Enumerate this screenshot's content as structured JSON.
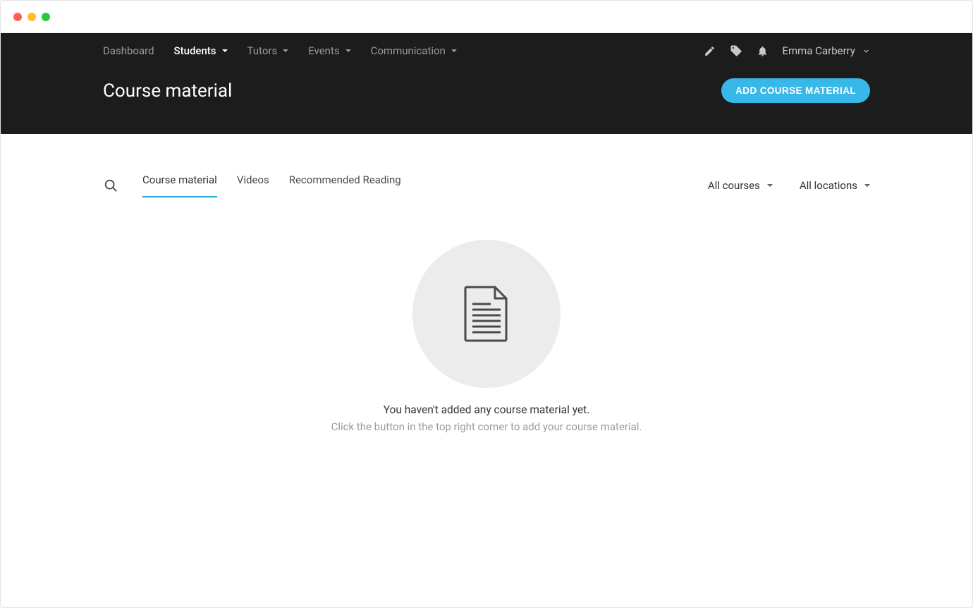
{
  "nav": {
    "items": [
      {
        "label": "Dashboard",
        "hasMenu": false
      },
      {
        "label": "Students",
        "hasMenu": true,
        "active": true
      },
      {
        "label": "Tutors",
        "hasMenu": true
      },
      {
        "label": "Events",
        "hasMenu": true
      },
      {
        "label": "Communication",
        "hasMenu": true
      }
    ],
    "user": "Emma Carberry"
  },
  "header": {
    "title": "Course material",
    "addButton": "ADD COURSE MATERIAL"
  },
  "tabs": [
    {
      "label": "Course material",
      "active": true
    },
    {
      "label": "Videos"
    },
    {
      "label": "Recommended Reading"
    }
  ],
  "filters": {
    "courses": "All courses",
    "locations": "All locations"
  },
  "empty": {
    "title": "You haven't added any course material yet.",
    "subtitle": "Click the button in the top right corner to add your course material."
  }
}
